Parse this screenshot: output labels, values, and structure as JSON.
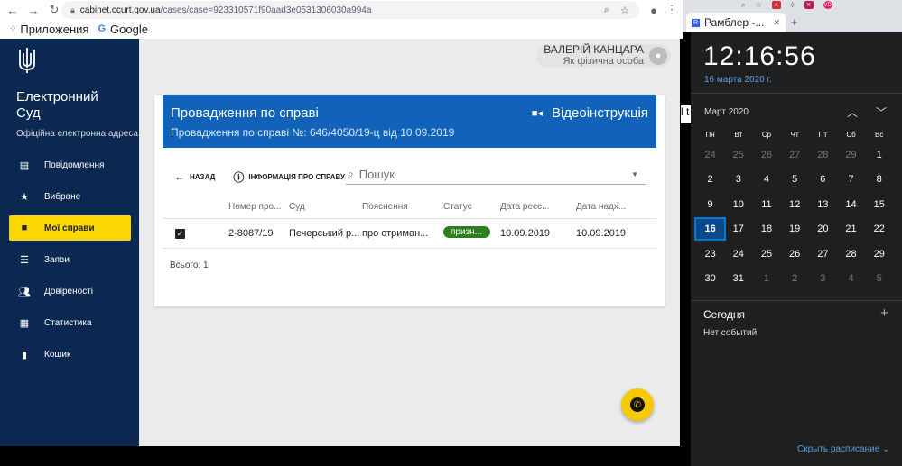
{
  "browser": {
    "url_host": "cabinet.ccurt.gov.ua",
    "url_path": "/cases/case=923310571f90aad3e0531306030a994a",
    "bookmarks": [
      {
        "label": "Приложения"
      },
      {
        "label": "Google"
      }
    ]
  },
  "sidebar": {
    "brand_title": "Електронний Суд",
    "brand_subtitle": "Офіційна електронна адреса",
    "items": [
      {
        "label": "Повідомлення",
        "icon": "message-icon"
      },
      {
        "label": "Вибране",
        "icon": "star-icon"
      },
      {
        "label": "Мої справи",
        "icon": "folder-icon",
        "active": true
      },
      {
        "label": "Заяви",
        "icon": "list-icon"
      },
      {
        "label": "Довіреності",
        "icon": "people-icon"
      },
      {
        "label": "Статистика",
        "icon": "chart-icon"
      },
      {
        "label": "Кошик",
        "icon": "trash-icon"
      }
    ]
  },
  "user": {
    "name": "ВАЛЕРІЙ КАНЦАРА",
    "role": "Як фізична особа"
  },
  "card": {
    "title": "Провадження по справі",
    "subtitle": "Провадження по справі №: 646/4050/19-ц від 10.09.2019",
    "video_label": "Відеоінструкція"
  },
  "toolbar": {
    "back_label": "НАЗАД",
    "info_label": "ІНФОРМАЦІЯ ПРО СПРАВУ",
    "search_placeholder": "Пошук"
  },
  "table": {
    "headers": [
      "",
      "Номер про...",
      "Суд",
      "Пояснення",
      "Статус",
      "Дата реєс...",
      "Дата надх..."
    ],
    "rows": [
      {
        "number": "2-8087/19",
        "court": "Печерський р...",
        "explanation": "про отриман...",
        "status": "призн...",
        "date_reg": "10.09.2019",
        "date_recv": "10.09.2019"
      }
    ],
    "total": "Всього: 1"
  },
  "tab": {
    "title": "Рамблер -...",
    "favicon": "R"
  },
  "clock": {
    "time": "12:16:56",
    "date": "16 марта 2020 г.",
    "month": "Март 2020",
    "weekdays": [
      "Пн",
      "Вт",
      "Ср",
      "Чт",
      "Пт",
      "Сб",
      "Вс"
    ],
    "weeks": [
      [
        "24",
        "25",
        "26",
        "27",
        "28",
        "29",
        "1"
      ],
      [
        "2",
        "3",
        "4",
        "5",
        "6",
        "7",
        "8"
      ],
      [
        "9",
        "10",
        "11",
        "12",
        "13",
        "14",
        "15"
      ],
      [
        "16",
        "17",
        "18",
        "19",
        "20",
        "21",
        "22"
      ],
      [
        "23",
        "24",
        "25",
        "26",
        "27",
        "28",
        "29"
      ],
      [
        "30",
        "31",
        "1",
        "2",
        "3",
        "4",
        "5"
      ]
    ],
    "today_label": "Сегодня",
    "no_events": "Нет событий",
    "hide_label": "Скрыть расписание ⌄"
  },
  "colors": {
    "sidebar_bg": "#0a2851",
    "active_nav": "#fbd601",
    "card_header": "#1063b8",
    "status_green": "#2e7d1f",
    "fab": "#f4c900"
  }
}
